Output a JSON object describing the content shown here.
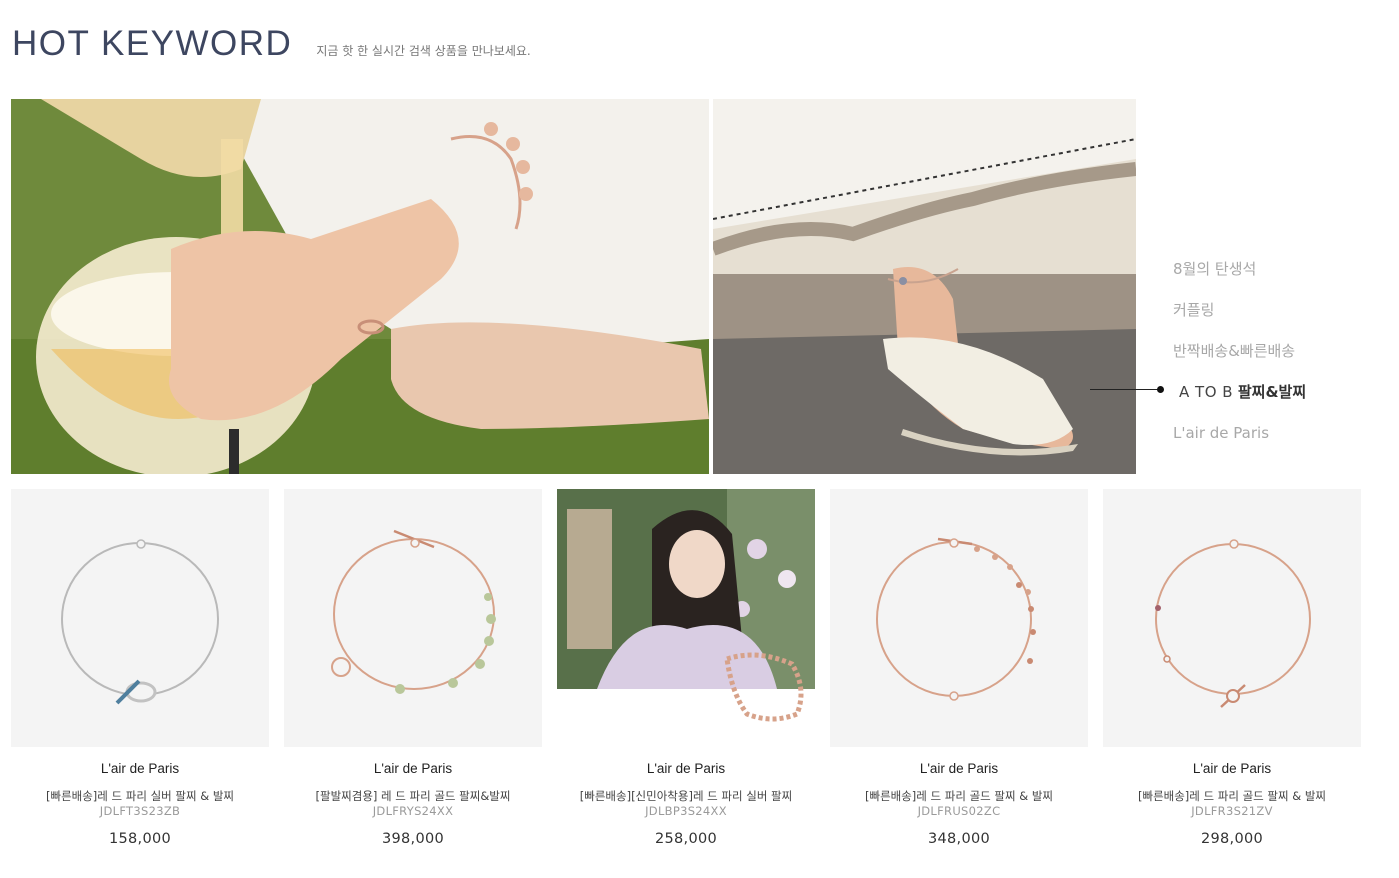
{
  "header": {
    "title": "HOT KEYWORD",
    "subtitle": "지금 핫 한 실시간 검색 상품을 만나보세요."
  },
  "keywords": [
    {
      "label": "8월의 탄생석"
    },
    {
      "label": "커플링"
    },
    {
      "label": "반짝배송&빠른배송"
    },
    {
      "label_latin": "A TO B",
      "label_bold": "팔찌&발찌",
      "active": true
    },
    {
      "label": "L'air de Paris"
    }
  ],
  "products": [
    {
      "brand": "L'air de Paris",
      "name": "[빠른배송]레 드 파리 실버 팔찌 & 발찌",
      "code": "JDLFT3S23ZB",
      "price": "158,000",
      "icon": "silver-toggle-bracelet"
    },
    {
      "brand": "L'air de Paris",
      "name": "[팔발찌겸용] 레 드 파리 골드 팔찌&발찌",
      "code": "JDLFRYS24XX",
      "price": "398,000",
      "icon": "rose-gold-green-bead-bracelet"
    },
    {
      "brand": "L'air de Paris",
      "name": "[빠른배송][신민아착용]레 드 파리 실버 팔찌",
      "code": "JDLBP3S24XX",
      "price": "258,000",
      "icon": "model-with-bracelet-photo"
    },
    {
      "brand": "L'air de Paris",
      "name": "[빠른배송]레 드 파리 골드 팔찌 & 발찌",
      "code": "JDLFRUS02ZC",
      "price": "348,000",
      "icon": "rose-gold-charm-bracelet"
    },
    {
      "brand": "L'air de Paris",
      "name": "[빠른배송]레 드 파리 골드 팔찌 & 발찌",
      "code": "JDLFR3S21ZV",
      "price": "298,000",
      "icon": "rose-gold-toggle-bracelet"
    }
  ],
  "colors": {
    "title": "#3d4660",
    "keyword_inactive": "#a8a8a8",
    "keyword_active": "#444444",
    "product_bg": "#f4f4f4",
    "silver": "#b8b8b8",
    "rose_gold": "#d7a28a",
    "jade": "#b9c79a"
  }
}
